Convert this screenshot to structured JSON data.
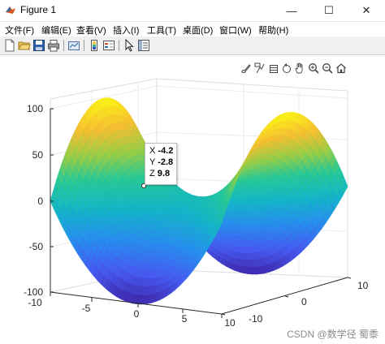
{
  "window": {
    "title": "Figure 1",
    "minimize_glyph": "—",
    "maximize_glyph": "☐",
    "close_glyph": "✕"
  },
  "menu": [
    {
      "label": "文件(F)"
    },
    {
      "label": "编辑(E)"
    },
    {
      "label": "查看(V)"
    },
    {
      "label": "插入(I)"
    },
    {
      "label": "工具(T)"
    },
    {
      "label": "桌面(D)"
    },
    {
      "label": "窗口(W)"
    },
    {
      "label": "帮助(H)"
    }
  ],
  "toolbar_icons": [
    "new-figure-icon",
    "open-file-icon",
    "save-icon",
    "print-icon",
    "link-plot-icon",
    "colorbar-icon",
    "legend-icon",
    "edit-plot-arrow-icon",
    "property-inspector-icon"
  ],
  "axes_toolbar_icons": [
    "brush-icon",
    "data-tips-icon",
    "rotate-3d-icon",
    "pan-hand-icon",
    "zoom-in-icon",
    "zoom-out-icon",
    "home-restore-icon"
  ],
  "axes": {
    "z_ticks": [
      "100",
      "50",
      "0",
      "-50",
      "-100"
    ],
    "x_ticks": [
      "-10",
      "-5",
      "0",
      "5",
      "10"
    ],
    "y_ticks": [
      "10",
      "0",
      "-10"
    ]
  },
  "datatip": {
    "x_label": "X",
    "x_value": "-4.2",
    "y_label": "Y",
    "y_value": "-2.8",
    "z_label": "Z",
    "z_value": "9.8"
  },
  "surface": {
    "type": "surface",
    "function": "z = x^2 - y^2",
    "x_range": [
      -10,
      10
    ],
    "y_range": [
      -10,
      10
    ],
    "z_range": [
      -100,
      100
    ],
    "colormap": "parula"
  },
  "watermark": "CSDN @数学径 蜀黍"
}
